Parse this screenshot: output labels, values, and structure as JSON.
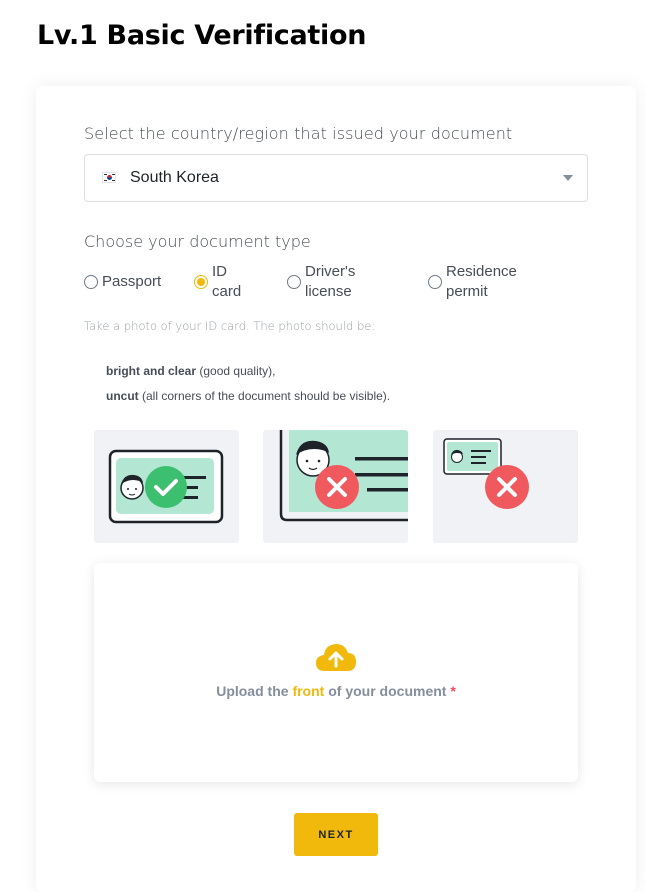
{
  "page": {
    "title": "Lv.1 Basic Verification"
  },
  "country": {
    "label": "Select the country/region that issued your document",
    "selected": "South Korea",
    "flag_icon": "south-korea-flag-icon"
  },
  "doc_type": {
    "label": "Choose your document type",
    "options": [
      {
        "line1": "Passport",
        "line2": "",
        "checked": false
      },
      {
        "line1": "ID",
        "line2": "card",
        "checked": true
      },
      {
        "line1": "Driver's",
        "line2": "license",
        "checked": false
      },
      {
        "line1": "Residence",
        "line2": "permit",
        "checked": false
      }
    ]
  },
  "instructions": {
    "intro": "Take a photo of your ID card. The photo should be:",
    "req1_bold": "bright and clear",
    "req1_rest": " (good quality),",
    "req2_bold": "uncut",
    "req2_rest": " (all corners of the document should be visible)."
  },
  "examples": [
    {
      "icon": "valid-id-photo-icon",
      "status": "correct"
    },
    {
      "icon": "cropped-id-photo-icon",
      "status": "incorrect"
    },
    {
      "icon": "too-small-id-photo-icon",
      "status": "incorrect"
    }
  ],
  "upload": {
    "prefix": "Upload the ",
    "highlight": "front",
    "suffix": " of your document ",
    "required_mark": "*",
    "icon": "cloud-upload-icon"
  },
  "actions": {
    "next_label": "NEXT"
  },
  "colors": {
    "accent": "#F0B90B",
    "success": "#3CBF6F",
    "error": "#F0595E",
    "card_fill": "#B4E6D4"
  }
}
